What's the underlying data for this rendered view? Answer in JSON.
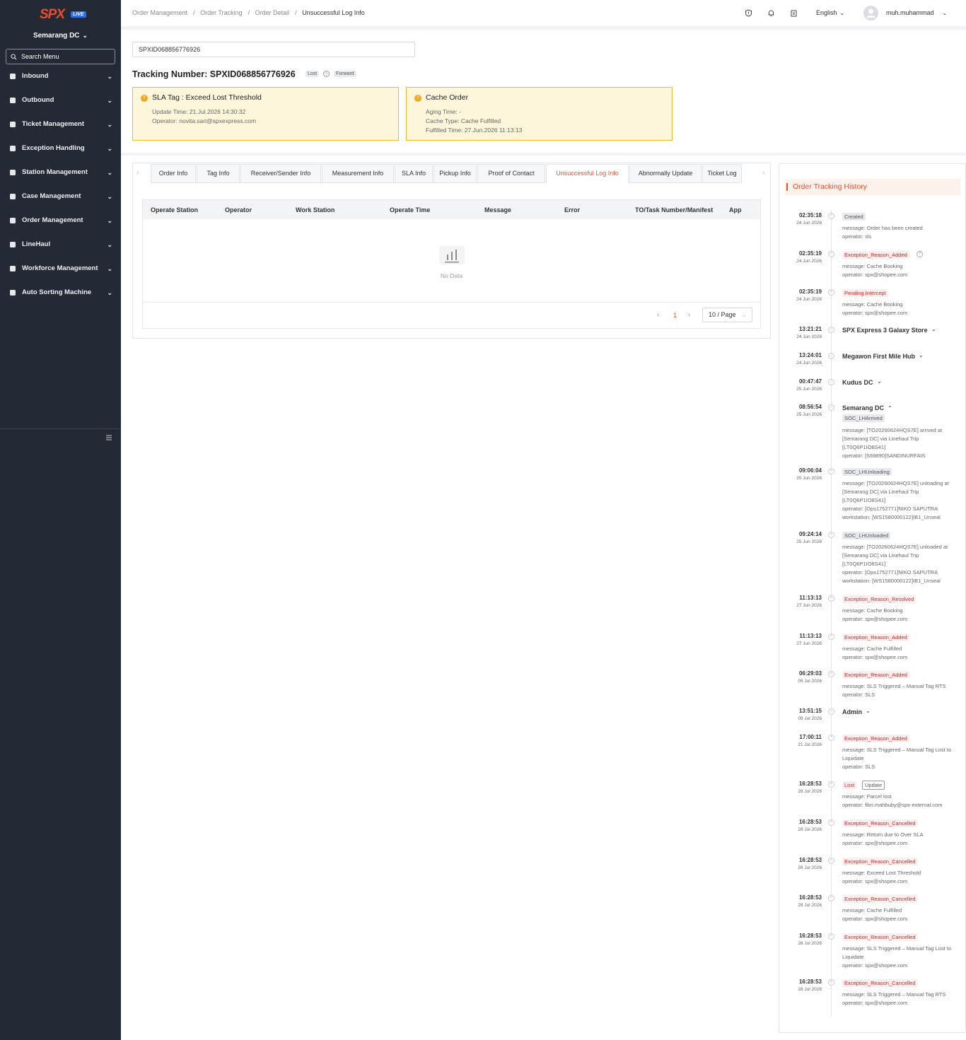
{
  "sidebar": {
    "logo_text": "SPX",
    "logo_badge": "LIVE",
    "station": "Semarang DC",
    "search_placeholder": "Search Menu",
    "items": [
      {
        "label": "Inbound",
        "icon": "inbound-icon"
      },
      {
        "label": "Outbound",
        "icon": "outbound-icon"
      },
      {
        "label": "Ticket Management",
        "icon": "ticket-icon"
      },
      {
        "label": "Exception Handling",
        "icon": "exception-icon"
      },
      {
        "label": "Station Management",
        "icon": "home-icon"
      },
      {
        "label": "Case Management",
        "icon": "case-icon"
      },
      {
        "label": "Order Management",
        "icon": "order-icon"
      },
      {
        "label": "LineHaul",
        "icon": "truck-icon"
      },
      {
        "label": "Workforce Management",
        "icon": "user-icon"
      },
      {
        "label": "Auto Sorting Machine",
        "icon": "sorting-icon"
      }
    ]
  },
  "header": {
    "breadcrumb": [
      "Order Management",
      "Order Tracking",
      "Order Detail",
      "Unsuccessful Log Info"
    ],
    "language": "English",
    "username": "muh.muhammad"
  },
  "main": {
    "search_value": "SPXID068856776926",
    "tracking_title": "Tracking Number: SPXID068856776926",
    "tag_lost": "Lost",
    "tag_forward": "Forward",
    "sla_alert": {
      "title": "SLA Tag : Exceed Lost Threshold",
      "update_time": "Update Time: 21.Jul.2026 14:30:32",
      "operator": "Operator: novita.sari@spxexpress.com"
    },
    "cache_alert": {
      "title": "Cache Order",
      "aging_time": "Aging Time: -",
      "cache_type": "Cache Type: Cache Fulfilled",
      "fulfilled_time": "Fulfilled Time: 27.Jun.2026 11:13:13"
    }
  },
  "tabs": [
    "Order Info",
    "Tag Info",
    "Receiver/Sender Info",
    "Measurement Info",
    "SLA Info",
    "Pickup Info",
    "Proof of Contact",
    "Unsuccessful Log Info",
    "Abnormally Update",
    "Ticket Log"
  ],
  "active_tab": "Unsuccessful Log Info",
  "table": {
    "columns": [
      "Operate Station",
      "Operator",
      "Work Station",
      "Operate Time",
      "Message",
      "Error",
      "TO/Task Number/Manifest",
      "App"
    ],
    "empty_text": "No Data",
    "page": "1",
    "page_size": "10 / Page"
  },
  "history": {
    "title": "Order Tracking History",
    "entries": [
      {
        "time": "02:35:18",
        "date": "24 Jun 2026",
        "status": "Created",
        "kind": "gray",
        "lines": [
          "message: Order has been created",
          "operator: sls"
        ]
      },
      {
        "time": "02:35:19",
        "date": "24 Jun 2026",
        "status": "Exception_Reason_Added",
        "kind": "red",
        "lines": [
          "message: Cache Booking",
          "operator: spx@shopee.com"
        ]
      },
      {
        "time": "02:35:19",
        "date": "24 Jun 2026",
        "status": "Pending Intercept",
        "kind": "red",
        "lines": [
          "message: Cache Booking",
          "operator: spx@shopee.com"
        ]
      },
      {
        "time": "13:21:21",
        "date": "24 Jun 2026",
        "status": "SPX Express 3 Galaxy Store",
        "kind": "plain",
        "lines": []
      },
      {
        "time": "13:24:01",
        "date": "24 Jun 2026",
        "status": "Megawon First Mile Hub",
        "kind": "plain",
        "lines": []
      },
      {
        "time": "00:47:47",
        "date": "25 Jun 2026",
        "status": "Kudus DC",
        "kind": "plain",
        "lines": []
      },
      {
        "time": "08:56:54",
        "date": "25 Jun 2026",
        "status": "Semarang DC",
        "kind": "plain",
        "sub": "SOC_LHArrived",
        "lines": [
          "message: [TO20260624HQS7E] arrived at",
          "[Semarang DC] via Linehaul Trip",
          "[LT0Q6P1IO8S41]",
          "operator: [S69890]SANDINURFAIS"
        ]
      },
      {
        "time": "09:06:04",
        "date": "25 Jun 2026",
        "status": "SOC_LHUnloading",
        "kind": "gray",
        "lines": [
          "message: [TO20260624HQS7E] unloading at",
          "[Semarang DC] via Linehaul Trip",
          "[LT0Q6P1IO8S41]",
          "operator: [Ops1752771]NIKO SAPUTRA",
          "workstation: [WS1580000122]IB1_Unseal"
        ]
      },
      {
        "time": "09:24:14",
        "date": "25 Jun 2026",
        "status": "SOC_LHUnloaded",
        "kind": "gray",
        "lines": [
          "message: [TO20260624HQS7E] unloaded at",
          "[Semarang DC] via Linehaul Trip",
          "[LT0Q6P1IO8S41]",
          "operator: [Ops1752771]NIKO SAPUTRA",
          "workstation: [WS1580000122]IB1_Unseal"
        ]
      },
      {
        "time": "11:13:13",
        "date": "27 Jun 2026",
        "status": "Exception_Reason_Resolved",
        "kind": "red",
        "lines": [
          "message: Cache Booking",
          "operator: spx@shopee.com"
        ]
      },
      {
        "time": "11:13:13",
        "date": "27 Jun 2026",
        "status": "Exception_Reason_Added",
        "kind": "red",
        "lines": [
          "message: Cache Fulfilled",
          "operator: spx@shopee.com"
        ]
      },
      {
        "time": "06:29:03",
        "date": "09 Jul 2026",
        "status": "Exception_Reason_Added",
        "kind": "red",
        "lines": [
          "message: SLS Triggered – Manual Tag RTS",
          "operator: SLS"
        ]
      },
      {
        "time": "13:51:15",
        "date": "09 Jul 2026",
        "status": "Admin",
        "kind": "plain",
        "lines": []
      },
      {
        "time": "17:00:11",
        "date": "21 Jul 2026",
        "status": "Exception_Reason_Added",
        "kind": "red",
        "lines": [
          "message: SLS Triggered – Manual Tag Lost to",
          "Liquidate",
          "operator: SLS"
        ]
      },
      {
        "time": "16:28:53",
        "date": "28 Jul 2026",
        "status": "Lost",
        "kind": "lost",
        "extra": "Update",
        "lines": [
          "message: Parcel lost",
          "operator: fikri.mahbuby@spx-external.com"
        ]
      },
      {
        "time": "16:28:53",
        "date": "28 Jul 2026",
        "status": "Exception_Reason_Cancelled",
        "kind": "red",
        "lines": [
          "message: Return due to Over SLA",
          "operator: spx@shopee.com"
        ]
      },
      {
        "time": "16:28:53",
        "date": "28 Jul 2026",
        "status": "Exception_Reason_Cancelled",
        "kind": "red",
        "lines": [
          "message: Exceed Lost Threshold",
          "operator: spx@shopee.com"
        ]
      },
      {
        "time": "16:28:53",
        "date": "28 Jul 2026",
        "status": "Exception_Reason_Cancelled",
        "kind": "red",
        "lines": [
          "message: Cache Fulfilled",
          "operator: spx@shopee.com"
        ]
      },
      {
        "time": "16:28:53",
        "date": "28 Jul 2026",
        "status": "Exception_Reason_Cancelled",
        "kind": "red",
        "lines": [
          "message: SLS Triggered – Manual Tag Lost to",
          "Liquidate",
          "operator: spx@shopee.com"
        ]
      },
      {
        "time": "16:28:53",
        "date": "28 Jul 2026",
        "status": "Exception_Reason_Cancelled",
        "kind": "red",
        "lines": [
          "message: SLS Triggered – Manual Tag RTS",
          "operator: spx@shopee.com"
        ]
      }
    ]
  }
}
